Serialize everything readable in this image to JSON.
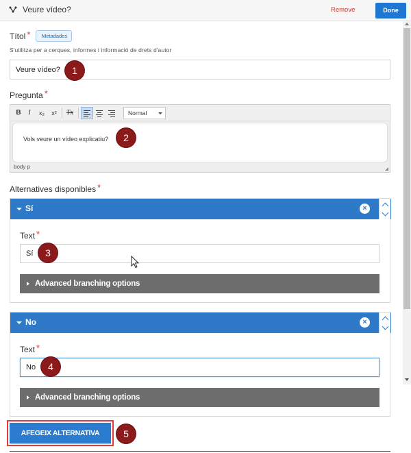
{
  "header": {
    "title": "Veure vídeo?",
    "remove_label": "Remove",
    "done_label": "Done"
  },
  "title_field": {
    "label": "Títol",
    "required_mark": "*",
    "metadata_tag": "Metadades",
    "help": "S'utilitza per a cerques, informes i informació de drets d'autor",
    "value": "Veure vídeo?"
  },
  "question_field": {
    "label": "Pregunta",
    "required_mark": "*",
    "toolbar": {
      "bold": "B",
      "italic": "I",
      "subscript": "x₂",
      "superscript": "x²",
      "clear_format": "Tx",
      "format_select": "Normal"
    },
    "text": "Vols veure un vídeo explicatiu?",
    "path": "body   p"
  },
  "alternatives": {
    "label": "Alternatives disponibles",
    "required_mark": "*",
    "items": [
      {
        "name": "Sí",
        "text_label": "Text",
        "required_mark": "*",
        "value": "Sí",
        "advanced_label": "Advanced branching options"
      },
      {
        "name": "No",
        "text_label": "Text",
        "required_mark": "*",
        "value": "No",
        "advanced_label": "Advanced branching options"
      }
    ],
    "add_label": "AFEGEIX ALTERNATIVA",
    "close_symbol": "×"
  },
  "markers": [
    "1",
    "2",
    "3",
    "4",
    "5"
  ],
  "colors": {
    "accent": "#2f7ac8",
    "done_button": "#1f77d3",
    "remove_text": "#c0392b",
    "marker": "#8b1a1a",
    "highlight_border": "#e03a3a",
    "advanced_bg": "#6d6d6d"
  },
  "icons": {
    "header": "branching-icon",
    "close": "close-circle-icon",
    "move_up": "chevron-up-icon",
    "move_down": "chevron-down-icon"
  }
}
